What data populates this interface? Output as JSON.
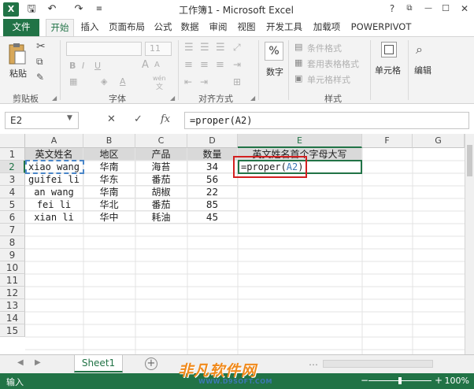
{
  "window": {
    "title": "工作簿1 - Microsoft Excel",
    "logo": "X",
    "help": "?",
    "controls": {
      "restore": "⧉",
      "minimize": "—",
      "maximize": "☐",
      "close": "✕"
    }
  },
  "quick_access": {
    "save": "🖫",
    "undo": "↶",
    "redo": "↷",
    "customize": "≡"
  },
  "tabs": [
    "文件",
    "开始",
    "插入",
    "页面布局",
    "公式",
    "数据",
    "审阅",
    "视图",
    "开发工具",
    "加载项",
    "POWERPIVOT"
  ],
  "active_tab": "开始",
  "ribbon": {
    "groups": {
      "clipboard": "剪贴板",
      "font": "字体",
      "alignment": "对齐方式",
      "styles": "样式"
    },
    "paste_label": "粘贴",
    "font_size": "11",
    "number_label": "数字",
    "number_symbol": "%",
    "cells_label": "单元格",
    "edit_label": "编辑",
    "conditional_format": "条件格式",
    "table_format": "套用表格格式",
    "cell_style": "单元格样式",
    "font_bold": "B",
    "font_italic": "I",
    "font_underline": "U",
    "font_grow": "A",
    "font_shrink": "A",
    "font_color": "A",
    "wen": "wén",
    "wen_char": "文"
  },
  "formula_bar": {
    "name_box": "E2",
    "cancel": "✕",
    "enter": "✓",
    "fx": "fx",
    "formula": "=proper(A2)"
  },
  "grid": {
    "columns": [
      "A",
      "B",
      "C",
      "D",
      "E",
      "F",
      "G"
    ],
    "selected_column": "E",
    "rows": [
      "1",
      "2",
      "3",
      "4",
      "5",
      "6",
      "7",
      "8",
      "9",
      "10",
      "11",
      "12",
      "13",
      "14",
      "15"
    ],
    "selected_row": "2",
    "header": [
      "英文姓名",
      "地区",
      "产品",
      "数量",
      "英文姓名首个字母大写"
    ],
    "data": [
      [
        "xiao wang",
        "华南",
        "海苔",
        "34"
      ],
      [
        "guifei li",
        "华东",
        "番茄",
        "56"
      ],
      [
        "an wang",
        "华南",
        "胡椒",
        "22"
      ],
      [
        "fei li",
        "华北",
        "番茄",
        "85"
      ],
      [
        "xian li",
        "华中",
        "耗油",
        "45"
      ]
    ],
    "editing_cell": {
      "prefix": "=proper(",
      "ref": "A2",
      "suffix": ")"
    }
  },
  "sheets": {
    "tabs": [
      "Sheet1"
    ],
    "active": "Sheet1",
    "add": "+",
    "nav_prev": "◀",
    "nav_next": "▶",
    "more": "…"
  },
  "status": {
    "mode": "输入",
    "zoom": "100%",
    "zoom_minus": "−",
    "zoom_plus": "+"
  },
  "watermark": {
    "text": "非凡软件网",
    "url": "WWW.D9SOFT.COM"
  },
  "colors": {
    "accent": "#217346",
    "ref_blue": "#3c78b4",
    "highlight_red": "#d32020",
    "watermark_orange": "#f08a1c"
  }
}
